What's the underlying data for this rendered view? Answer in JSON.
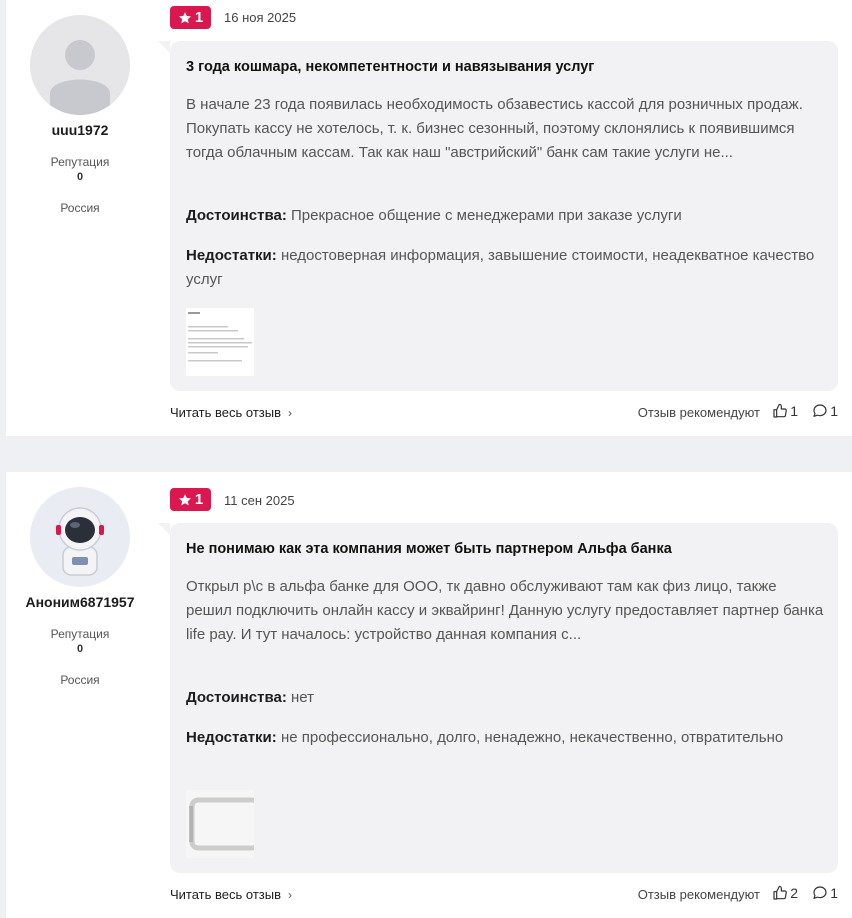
{
  "reviews": [
    {
      "author": {
        "name": "uuu1972",
        "reputation_label": "Репутация",
        "reputation_value": "0",
        "country": "Россия",
        "avatar": "default-user-avatar"
      },
      "rating": "1",
      "date": "16 ноя 2025",
      "title": "3 года кошмара, некомпетентности и навязывания услуг",
      "body": "В начале 23 года появилась необходимость обзавестись кассой для розничных продаж. Покупать кассу не хотелось, т. к. бизнес сезонный, поэтому склонялись к появившимся тогда облачным кассам. Так как наш \"австрийский\" банк сам такие услуги не...",
      "pros_label": "Достоинства:",
      "pros": "Прекрасное общение с менеджерами при заказе услуги",
      "cons_label": "Недостатки:",
      "cons": "недостоверная информация, завышение стоимости, неадекватное качество услуг",
      "read_more": "Читать весь отзыв",
      "recommend_label": "Отзыв рекомендуют",
      "likes": "1",
      "comments": "1"
    },
    {
      "author": {
        "name": "Аноним6871957",
        "reputation_label": "Репутация",
        "reputation_value": "0",
        "country": "Россия",
        "avatar": "astronaut-avatar"
      },
      "rating": "1",
      "date": "11 сен 2025",
      "title": "Не понимаю как эта компания может быть партнером Альфа банка",
      "body": "Открыл р\\с в альфа банке для ООО, тк давно обслуживают там как физ лицо, также решил подключить онлайн кассу и эквайринг! Данную услугу предоставляет партнер банка life pay. И тут началось: устройство данная компания с...",
      "pros_label": "Достоинства:",
      "pros": "нет",
      "cons_label": "Недостатки:",
      "cons": "не профессионально, долго, ненадежно, некачественно, отвратительно",
      "read_more": "Читать весь отзыв",
      "recommend_label": "Отзыв рекомендуют",
      "likes": "2",
      "comments": "1"
    }
  ],
  "colors": {
    "badge": "#d8184e",
    "bubble": "#f2f2f4",
    "page_bg": "#eef0f3"
  }
}
